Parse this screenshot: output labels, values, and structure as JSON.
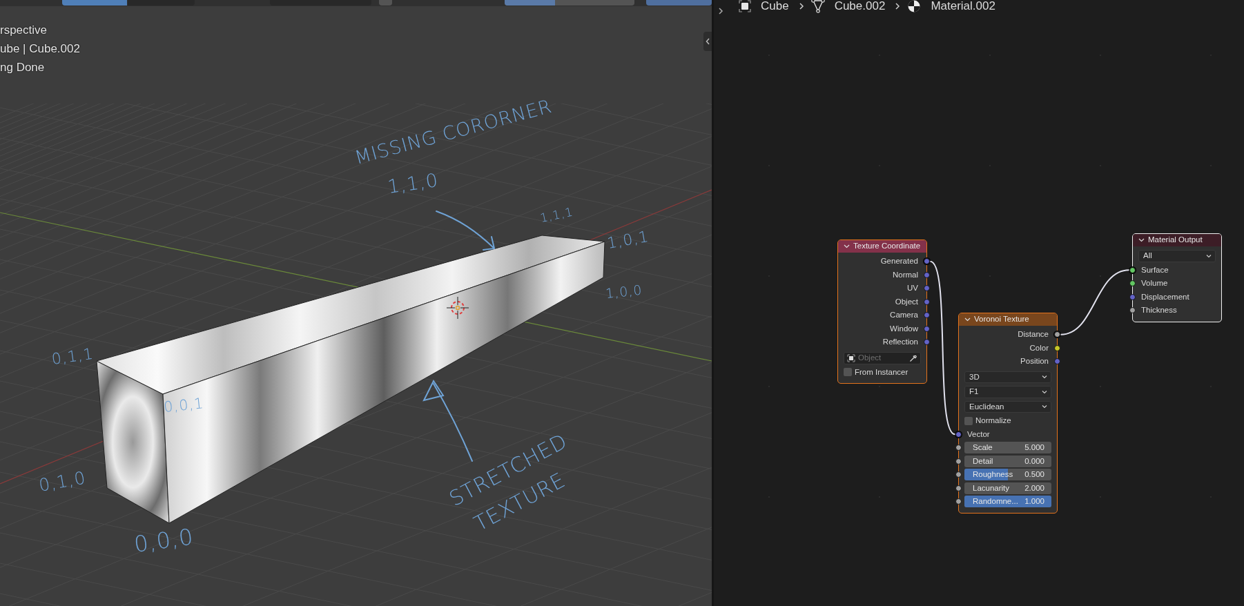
{
  "toolbar": {
    "buttons": [
      {
        "selected": true
      },
      {
        "selected": false
      }
    ],
    "checkbox": {
      "checked": false
    },
    "slider": {
      "level": 0.39
    }
  },
  "viewport": {
    "info_lines": [
      "rspective",
      "ube | Cube.002",
      "ng Done"
    ],
    "annotations": [
      {
        "text": "MISSING CORORNER"
      },
      {
        "text": "1,1,0"
      },
      {
        "text": "1,1,1"
      },
      {
        "text": "1,0,1"
      },
      {
        "text": "1,0,0"
      },
      {
        "text": "0,1,1"
      },
      {
        "text": "0,0,1"
      },
      {
        "text": "0,1,0"
      },
      {
        "text": "0,0,0"
      },
      {
        "text": "STRETCHED"
      },
      {
        "text": "TEXTURE"
      }
    ]
  },
  "breadcrumb": [
    {
      "label": "Cube",
      "kind": "object"
    },
    {
      "label": "Cube.002",
      "kind": "mesh"
    },
    {
      "label": "Material.002",
      "kind": "material"
    }
  ],
  "nodes": [
    {
      "title": "Texture Coordinate",
      "kind": "input",
      "selected": true,
      "active": false,
      "outputs": [
        {
          "label": "Generated",
          "color": "#6363c7",
          "linked": true
        },
        {
          "label": "Normal",
          "color": "#6363c7",
          "linked": false
        },
        {
          "label": "UV",
          "color": "#6363c7",
          "linked": false
        },
        {
          "label": "Object",
          "color": "#6363c7",
          "linked": false
        },
        {
          "label": "Camera",
          "color": "#6363c7",
          "linked": false
        },
        {
          "label": "Window",
          "color": "#6363c7",
          "linked": false
        },
        {
          "label": "Reflection",
          "color": "#6363c7",
          "linked": false
        }
      ],
      "object_field": {
        "placeholder": "Object"
      },
      "checkboxes": [
        {
          "label": "From Instancer",
          "checked": false
        }
      ]
    },
    {
      "title": "Voronoi Texture",
      "kind": "texture",
      "selected": true,
      "active": false,
      "outputs": [
        {
          "label": "Distance",
          "color": "#a1a1a1",
          "linked": true
        },
        {
          "label": "Color",
          "color": "#c7c729",
          "linked": false
        },
        {
          "label": "Position",
          "color": "#6363c7",
          "linked": false
        }
      ],
      "dropdowns": [
        "3D",
        "F1",
        "Euclidean"
      ],
      "checkboxes": [
        {
          "label": "Normalize",
          "checked": false
        }
      ],
      "inputs": [
        {
          "label": "Vector",
          "color": "#6363c7",
          "linked": true,
          "kind": "socket"
        },
        {
          "label": "Scale",
          "color": "#a1a1a1",
          "linked": false,
          "kind": "number",
          "value": "5.000"
        },
        {
          "label": "Detail",
          "color": "#a1a1a1",
          "linked": false,
          "kind": "number",
          "value": "0.000"
        },
        {
          "label": "Roughness",
          "color": "#a1a1a1",
          "linked": false,
          "kind": "slider",
          "value": "0.500",
          "level": 0.5
        },
        {
          "label": "Lacunarity",
          "color": "#a1a1a1",
          "linked": false,
          "kind": "number",
          "value": "2.000"
        },
        {
          "label": "Randomne...",
          "color": "#a1a1a1",
          "linked": false,
          "kind": "slider",
          "value": "1.000",
          "level": 1.0
        }
      ]
    },
    {
      "title": "Material Output",
      "kind": "output",
      "selected": true,
      "active": true,
      "dropdowns": [
        "All"
      ],
      "inputs": [
        {
          "label": "Surface",
          "color": "#63c763",
          "linked": true,
          "kind": "socket"
        },
        {
          "label": "Volume",
          "color": "#63c763",
          "linked": false,
          "kind": "socket"
        },
        {
          "label": "Displacement",
          "color": "#6363c7",
          "linked": false,
          "kind": "socket"
        },
        {
          "label": "Thickness",
          "color": "#a1a1a1",
          "linked": false,
          "kind": "socket"
        }
      ]
    }
  ]
}
